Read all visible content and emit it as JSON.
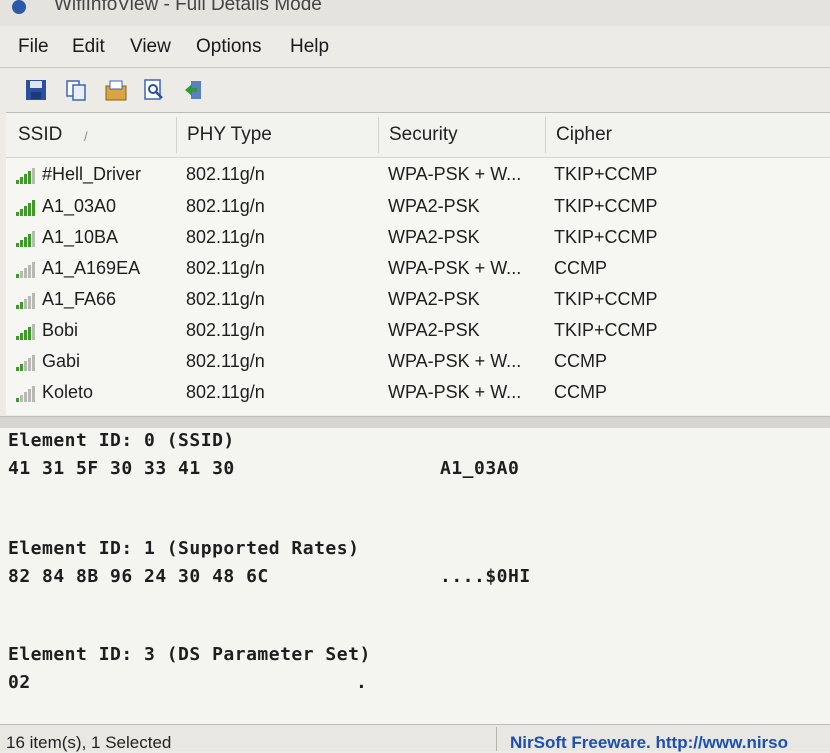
{
  "window": {
    "title": "WifiInfoView  -  Full Details Mode"
  },
  "menu": [
    "File",
    "Edit",
    "View",
    "Options",
    "Help"
  ],
  "toolbar": [
    {
      "name": "save-icon"
    },
    {
      "name": "copy-icon"
    },
    {
      "name": "properties-icon"
    },
    {
      "name": "find-icon"
    },
    {
      "name": "exit-icon"
    }
  ],
  "columns": [
    "SSID",
    "PHY Type",
    "Security",
    "Cipher"
  ],
  "sort_indicator": "/",
  "rows": [
    {
      "ssid": "#Hell_Driver",
      "phy": "802.11g/n",
      "security": "WPA-PSK + W...",
      "cipher": "TKIP+CCMP",
      "signal": 4
    },
    {
      "ssid": "A1_03A0",
      "phy": "802.11g/n",
      "security": "WPA2-PSK",
      "cipher": "TKIP+CCMP",
      "signal": 5
    },
    {
      "ssid": "A1_10BA",
      "phy": "802.11g/n",
      "security": "WPA2-PSK",
      "cipher": "TKIP+CCMP",
      "signal": 4
    },
    {
      "ssid": "A1_A169EA",
      "phy": "802.11g/n",
      "security": "WPA-PSK + W...",
      "cipher": "CCMP",
      "signal": 1
    },
    {
      "ssid": "A1_FA66",
      "phy": "802.11g/n",
      "security": "WPA2-PSK",
      "cipher": "TKIP+CCMP",
      "signal": 2
    },
    {
      "ssid": "Bobi",
      "phy": "802.11g/n",
      "security": "WPA2-PSK",
      "cipher": "TKIP+CCMP",
      "signal": 4
    },
    {
      "ssid": "Gabi",
      "phy": "802.11g/n",
      "security": "WPA-PSK + W...",
      "cipher": "CCMP",
      "signal": 2
    },
    {
      "ssid": "Koleto",
      "phy": "802.11g/n",
      "security": "WPA-PSK + W...",
      "cipher": "CCMP",
      "signal": 1
    }
  ],
  "selected_index": 1,
  "details": [
    {
      "header": "Element ID: 0  (SSID)",
      "hex": "41 31 5F 30 33 41 30",
      "ascii": "A1_03A0"
    },
    {
      "header": "Element ID: 1  (Supported Rates)",
      "hex": "82 84 8B 96 24 30 48 6C",
      "ascii": "....$0HI"
    },
    {
      "header": "Element ID: 3  (DS Parameter Set)",
      "hex": "02",
      "ascii": "."
    }
  ],
  "status": {
    "left": "16 item(s), 1 Selected",
    "right": "NirSoft Freeware.  http://www.nirso"
  },
  "colors": {
    "selection": "#2f77d2",
    "signal_on": "#3f9a2a",
    "signal_off": "#b9b9b4",
    "link": "#1b4fb3"
  }
}
